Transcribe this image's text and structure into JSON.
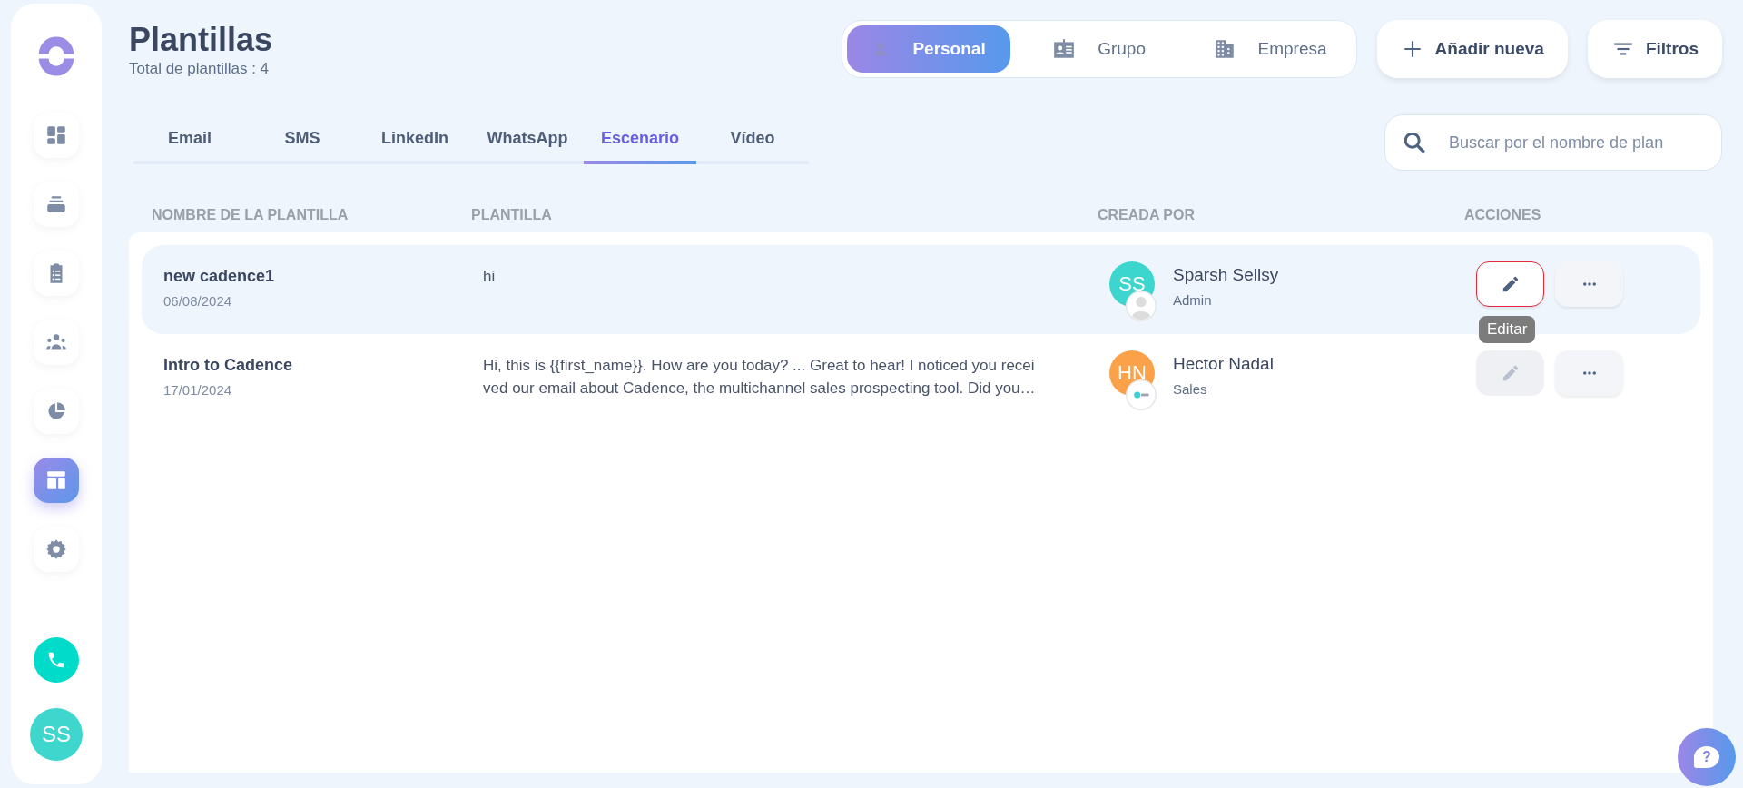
{
  "sidebar": {
    "items": [
      {
        "kind": "dashboard",
        "selected": false
      },
      {
        "kind": "stack",
        "selected": false
      },
      {
        "kind": "clipboard",
        "selected": false
      },
      {
        "kind": "people",
        "selected": false
      },
      {
        "kind": "pie",
        "selected": false
      },
      {
        "kind": "template",
        "selected": true
      },
      {
        "kind": "gear",
        "selected": false
      }
    ],
    "user_initials": "SS"
  },
  "header": {
    "title": "Plantillas",
    "subtitle": "Total de plantillas : 4"
  },
  "scope_tabs": [
    {
      "kind": "person",
      "label": "Personal",
      "selected": true
    },
    {
      "kind": "badge",
      "label": "Grupo",
      "selected": false
    },
    {
      "kind": "building",
      "label": "Empresa",
      "selected": false
    }
  ],
  "add_button": "Añadir nueva",
  "filter_button": "Filtros",
  "tabs": [
    {
      "label": "Email",
      "selected": false
    },
    {
      "label": "SMS",
      "selected": false
    },
    {
      "label": "LinkedIn",
      "selected": false
    },
    {
      "label": "WhatsApp",
      "selected": false
    },
    {
      "label": "Escenario",
      "selected": true
    },
    {
      "label": "Vídeo",
      "selected": false
    }
  ],
  "search": {
    "placeholder": "Buscar por el nombre de plan"
  },
  "table": {
    "columns": [
      "NOMBRE DE LA PLANTILLA",
      "PLANTILLA",
      "CREADA POR",
      "ACCIONES"
    ],
    "rows": [
      {
        "name": "new cadence1",
        "date": "06/08/2024",
        "template_lines": [
          "hi"
        ],
        "initials": "SS",
        "color": "#3dd6cf",
        "kind": "person",
        "creator": "Sparsh Sellsy",
        "role": "Admin",
        "highlighted": true,
        "edit_focused": true,
        "edit_disabled": false,
        "tooltip": "Editar"
      },
      {
        "name": "Intro to Cadence",
        "date": "17/01/2024",
        "template_lines": [
          "Hi, this is {{first_name}}. How are you today? ... Great to hear! I noticed you recei",
          "ved our email about Cadence, the multichannel sales prospecting tool. Did you…"
        ],
        "initials": "HN",
        "color": "#fba14a",
        "kind": "logo",
        "creator": "Hector Nadal",
        "role": "Sales",
        "highlighted": false,
        "edit_focused": false,
        "edit_disabled": true
      }
    ]
  },
  "help_button": "?"
}
